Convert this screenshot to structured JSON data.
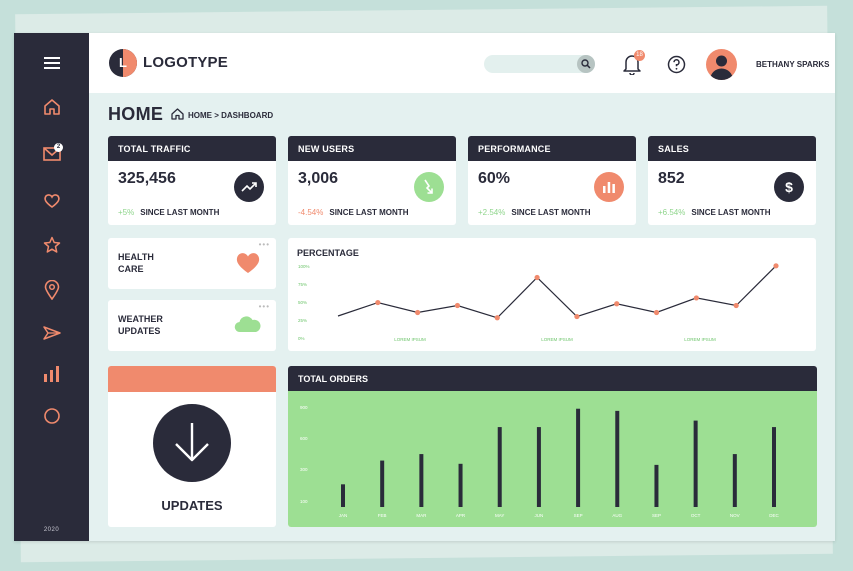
{
  "app": {
    "logo_letter": "L",
    "logo_text": "LOGOTYPE",
    "footer_year": "2020",
    "colors": {
      "dark": "#2a2b3a",
      "accent": "#f08a6d",
      "green": "#9ddf93",
      "bg": "#e4f1f0"
    }
  },
  "sidebar": {
    "items": [
      {
        "icon": "menu-icon"
      },
      {
        "icon": "home-icon"
      },
      {
        "icon": "mail-icon",
        "badge": "2"
      },
      {
        "icon": "heart-icon"
      },
      {
        "icon": "star-icon"
      },
      {
        "icon": "location-icon"
      },
      {
        "icon": "send-icon"
      },
      {
        "icon": "bar-chart-icon"
      },
      {
        "icon": "circle-icon"
      }
    ]
  },
  "header": {
    "search_placeholder": "",
    "notification_count": "18",
    "user_name": "BETHANY SPARKS"
  },
  "page": {
    "title": "HOME",
    "breadcrumb": "HOME > DASHBOARD"
  },
  "stats": [
    {
      "title": "TOTAL TRAFFIC",
      "value": "325,456",
      "change": "+5%",
      "change_dir": "pos",
      "since": "SINCE LAST MONTH",
      "icon": "trend-up-icon",
      "icon_color": "#2a2b3a"
    },
    {
      "title": "NEW USERS",
      "value": "3,006",
      "change": "-4.54%",
      "change_dir": "neg",
      "since": "SINCE LAST MONTH",
      "icon": "trend-down-icon",
      "icon_color": "#9ddf93"
    },
    {
      "title": "PERFORMANCE",
      "value": "60%",
      "change": "+2.54%",
      "change_dir": "pos",
      "since": "SINCE LAST MONTH",
      "icon": "bar-chart-icon",
      "icon_color": "#f08a6d"
    },
    {
      "title": "SALES",
      "value": "852",
      "change": "+6.54%",
      "change_dir": "pos",
      "since": "SINCE LAST MONTH",
      "icon": "dollar-icon",
      "icon_color": "#2a2b3a"
    }
  ],
  "widgets": {
    "health": {
      "line1": "HEALTH",
      "line2": "CARE",
      "dots": "•••"
    },
    "weather": {
      "line1": "WEATHER",
      "line2": "UPDATES",
      "dots": "•••"
    }
  },
  "updates": {
    "label": "UPDATES"
  },
  "chart_data": [
    {
      "type": "line",
      "title": "PERCENTAGE",
      "y_ticks": [
        "100%",
        "75%",
        "50%",
        "25%",
        "0%"
      ],
      "x_labels": [
        "LOREM IPSUM",
        "LOREM IPSUM",
        "LOREM IPSUM"
      ],
      "values": [
        24,
        47,
        30,
        42,
        21,
        90,
        23,
        45,
        30,
        55,
        42,
        110
      ],
      "marked": [
        false,
        true,
        true,
        true,
        true,
        true,
        true,
        true,
        true,
        true,
        true,
        true
      ],
      "ylim": [
        0,
        120
      ],
      "grid": false
    },
    {
      "type": "bar",
      "title": "TOTAL ORDERS",
      "categories": [
        "JAN",
        "FEB",
        "MAR",
        "APR",
        "MAY",
        "JUN",
        "SEP",
        "AUG",
        "SEP",
        "OCT",
        "NOV",
        "DEC"
      ],
      "values": [
        210,
        430,
        490,
        400,
        740,
        740,
        910,
        890,
        390,
        800,
        490,
        740
      ],
      "y_ticks": [
        "900",
        "600",
        "300",
        "100"
      ],
      "ylim": [
        0,
        1000
      ],
      "grid": false
    }
  ]
}
